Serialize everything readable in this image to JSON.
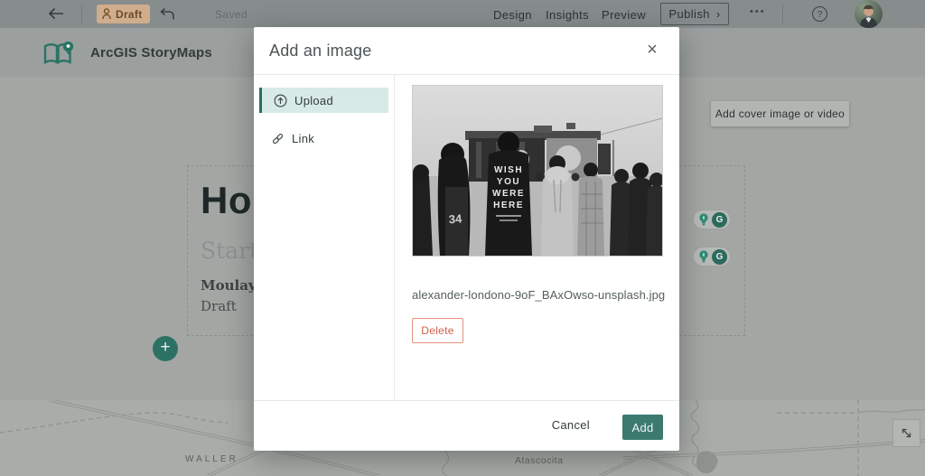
{
  "topbar": {
    "back": "←",
    "draft_label": "Draft",
    "saved": "Saved",
    "nav": [
      {
        "label": "Design"
      },
      {
        "label": "Insights"
      },
      {
        "label": "Preview"
      }
    ],
    "publish_label": "Publish",
    "publish_chevron": "›",
    "more": "•••",
    "help": "?"
  },
  "brand": {
    "name": "ArcGIS StoryMaps"
  },
  "story": {
    "title_visible": "Ho",
    "subtitle_visible": "Start w",
    "byline_visible": "Moulay A",
    "status": "Draft",
    "add_button": "+",
    "add_cover_label": "Add cover image or video"
  },
  "assist": {
    "g_label": "G"
  },
  "map": {
    "labels": {
      "waller": "WALLER",
      "atascocita": "Atascocita"
    }
  },
  "modal": {
    "title": "Add an image",
    "close": "×",
    "tabs": [
      {
        "label": "Upload"
      },
      {
        "label": "Link"
      }
    ],
    "filename": "alexander-londono-9oF_BAxOwso-unsplash.jpg",
    "delete_label": "Delete",
    "cancel_label": "Cancel",
    "add_label": "Add"
  },
  "photo": {
    "shirt": [
      "WISH",
      "YOU",
      "WERE",
      "HERE"
    ],
    "jersey": "34",
    "description": "Black-and-white photo of a concert crowd facing an outdoor stage"
  },
  "colors": {
    "accent_teal": "#2c7164",
    "add_button": "#3c7a70",
    "upload_highlight": "#d8eae5",
    "delete_red": "#cf5f4a",
    "draft_badge": "#cfad8d"
  }
}
